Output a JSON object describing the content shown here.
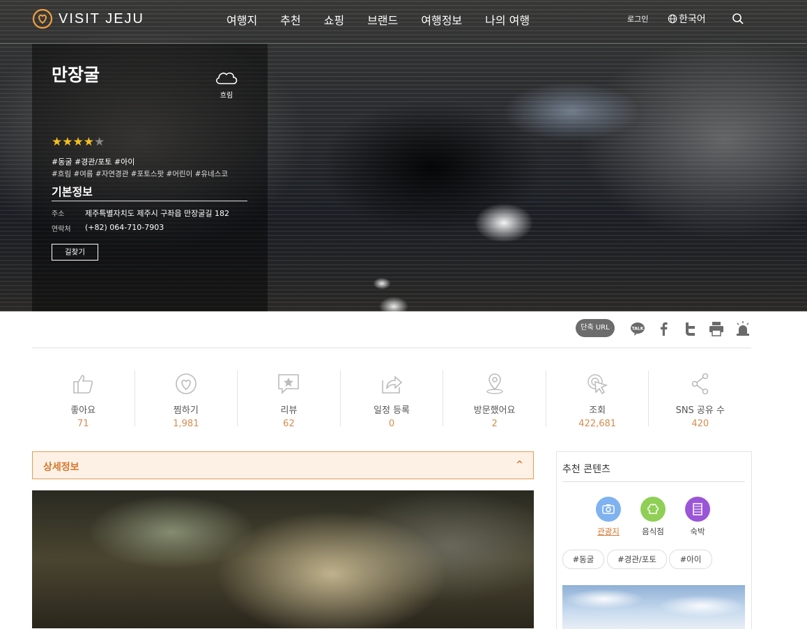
{
  "nav": {
    "logo_text": "VISIT JEJU",
    "menu": [
      "여행지",
      "추천",
      "쇼핑",
      "브랜드",
      "여행정보",
      "나의 여행"
    ],
    "login": "로그인",
    "language": "한국어"
  },
  "hero": {
    "title": "만장굴",
    "weather": "흐림",
    "rating": 4,
    "rating_max": 5,
    "tags_primary": "#동굴 #경관/포토 #아이",
    "tags_secondary": "#흐림 #여름 #자연경관 #포토스팟 #어린이 #유네스코",
    "basic_info_title": "기본정보",
    "address_label": "주소",
    "address": "제주특별자치도 제주시 구좌읍 만장굴길 182",
    "contact_label": "연락처",
    "contact": "(+82) 064-710-7903",
    "directions_button": "길찾기"
  },
  "share": {
    "short_url": "단축 URL",
    "kakao_icon_text": "TALK"
  },
  "stats": [
    {
      "label": "좋아요",
      "value": "71",
      "icon": "thumbs-up-icon"
    },
    {
      "label": "찜하기",
      "value": "1,981",
      "icon": "heart-icon"
    },
    {
      "label": "리뷰",
      "value": "62",
      "icon": "review-icon"
    },
    {
      "label": "일정 등록",
      "value": "0",
      "icon": "schedule-share-icon"
    },
    {
      "label": "방문했어요",
      "value": "2",
      "icon": "location-pin-icon"
    },
    {
      "label": "조회",
      "value": "422,681",
      "icon": "cursor-click-icon"
    },
    {
      "label": "SNS 공유 수",
      "value": "420",
      "icon": "share-nodes-icon"
    }
  ],
  "detail": {
    "title": "상세정보",
    "caret": "^"
  },
  "sidebar": {
    "title": "추천 콘텐츠",
    "categories": [
      {
        "label": "관광지",
        "color": "#7fb2f0",
        "icon": "camera-icon",
        "active": true
      },
      {
        "label": "음식점",
        "color": "#8fcf56",
        "icon": "chef-hat-icon",
        "active": false
      },
      {
        "label": "숙박",
        "color": "#9a55d8",
        "icon": "building-icon",
        "active": false
      }
    ],
    "chips": [
      "#동굴",
      "#경관/포토",
      "#아이"
    ]
  },
  "colors": {
    "accent": "#d4762d",
    "stat_value": "#d58b4f",
    "star": "#f4c020"
  }
}
